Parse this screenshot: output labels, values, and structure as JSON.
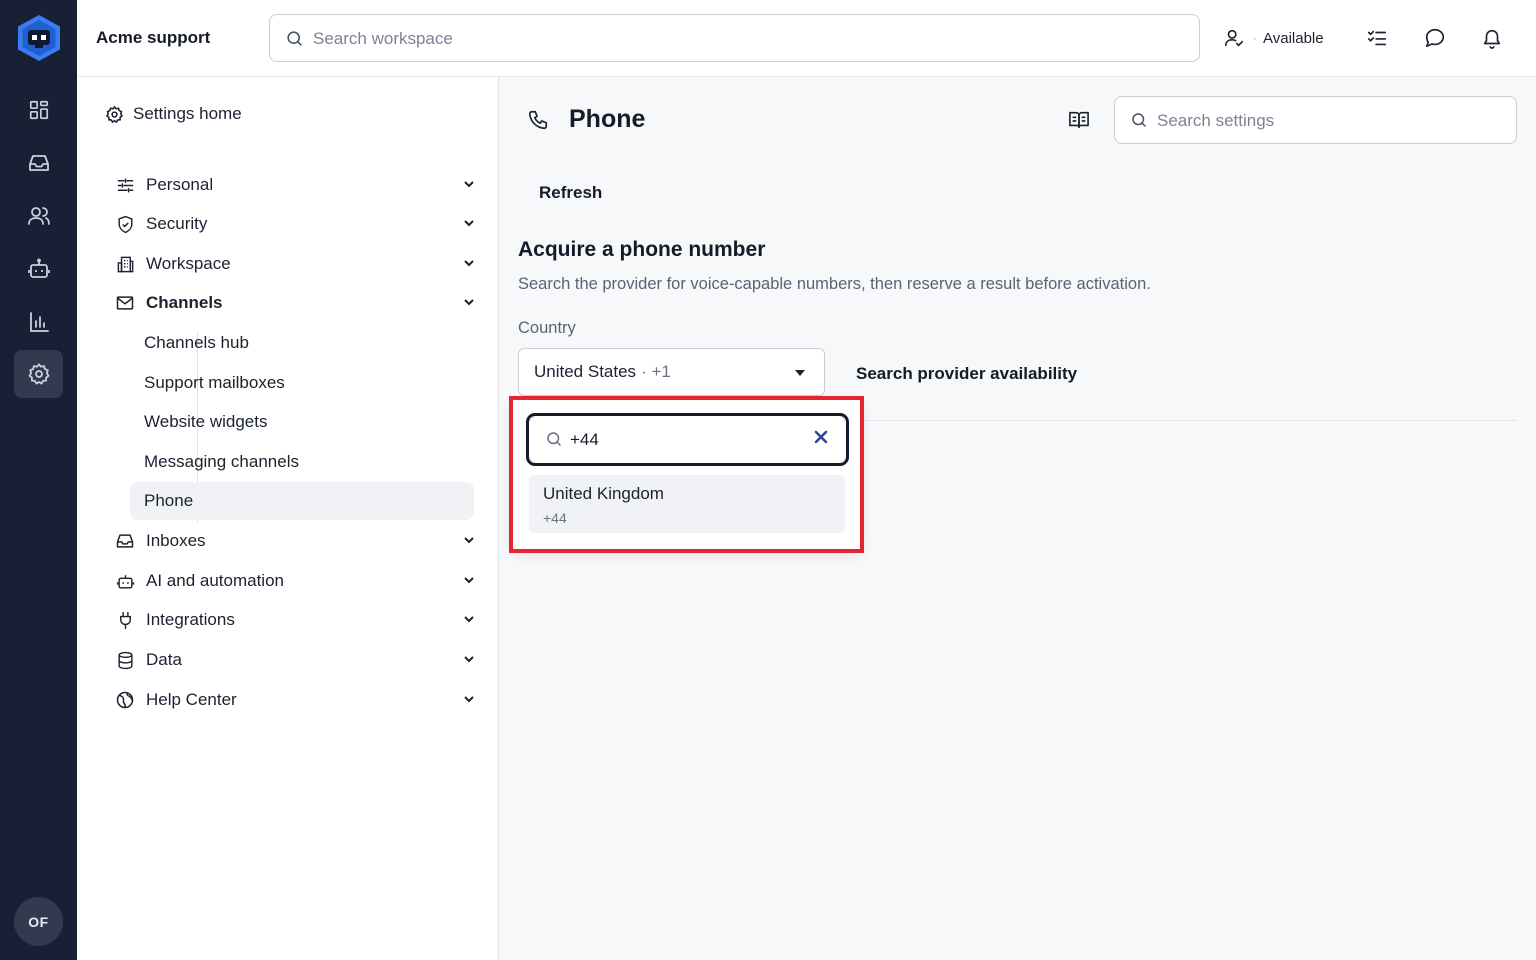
{
  "rail": {
    "logo_icon": "bot-hexagon-logo",
    "items": [
      {
        "icon": "dashboard-grid-icon"
      },
      {
        "icon": "inbox-icon"
      },
      {
        "icon": "users-icon"
      },
      {
        "icon": "bot-icon"
      },
      {
        "icon": "bar-chart-icon"
      },
      {
        "icon": "gear-icon",
        "active": true
      }
    ],
    "avatar_initials": "OF"
  },
  "topbar": {
    "brand": "Acme support",
    "search_placeholder": "Search workspace",
    "status_label": "Available",
    "icons": [
      "user-status-icon",
      "checklist-icon",
      "chat-bubble-icon",
      "bell-icon"
    ]
  },
  "settings_nav": {
    "home_label": "Settings home",
    "items": [
      {
        "label": "Personal",
        "icon": "sliders-icon"
      },
      {
        "label": "Security",
        "icon": "shield-icon"
      },
      {
        "label": "Workspace",
        "icon": "building-icon"
      },
      {
        "label": "Channels",
        "icon": "mail-icon",
        "expanded": true
      },
      {
        "label": "Inboxes",
        "icon": "inbox-icon"
      },
      {
        "label": "AI and automation",
        "icon": "bot-icon"
      },
      {
        "label": "Integrations",
        "icon": "plug-icon"
      },
      {
        "label": "Data",
        "icon": "database-icon"
      },
      {
        "label": "Help Center",
        "icon": "globe-icon"
      }
    ],
    "channels_children": [
      {
        "label": "Channels hub"
      },
      {
        "label": "Support mailboxes"
      },
      {
        "label": "Website widgets"
      },
      {
        "label": "Messaging channels"
      },
      {
        "label": "Phone",
        "active": true
      }
    ]
  },
  "main": {
    "title": "Phone",
    "search_settings_placeholder": "Search settings",
    "refresh_label": "Refresh",
    "section_title": "Acquire a phone number",
    "section_desc": "Search the provider for voice-capable numbers, then reserve a result before activation.",
    "country_label": "Country",
    "country_selected": "United States",
    "country_selected_code": "· +1",
    "search_availability_label": "Search provider availability"
  },
  "dropdown": {
    "search_value": "+44",
    "options": [
      {
        "name": "United Kingdom",
        "dial": "+44"
      }
    ]
  },
  "colors": {
    "rail_bg": "#182035",
    "highlight_border": "#e3262f",
    "clear_icon": "#2b4d8a"
  }
}
